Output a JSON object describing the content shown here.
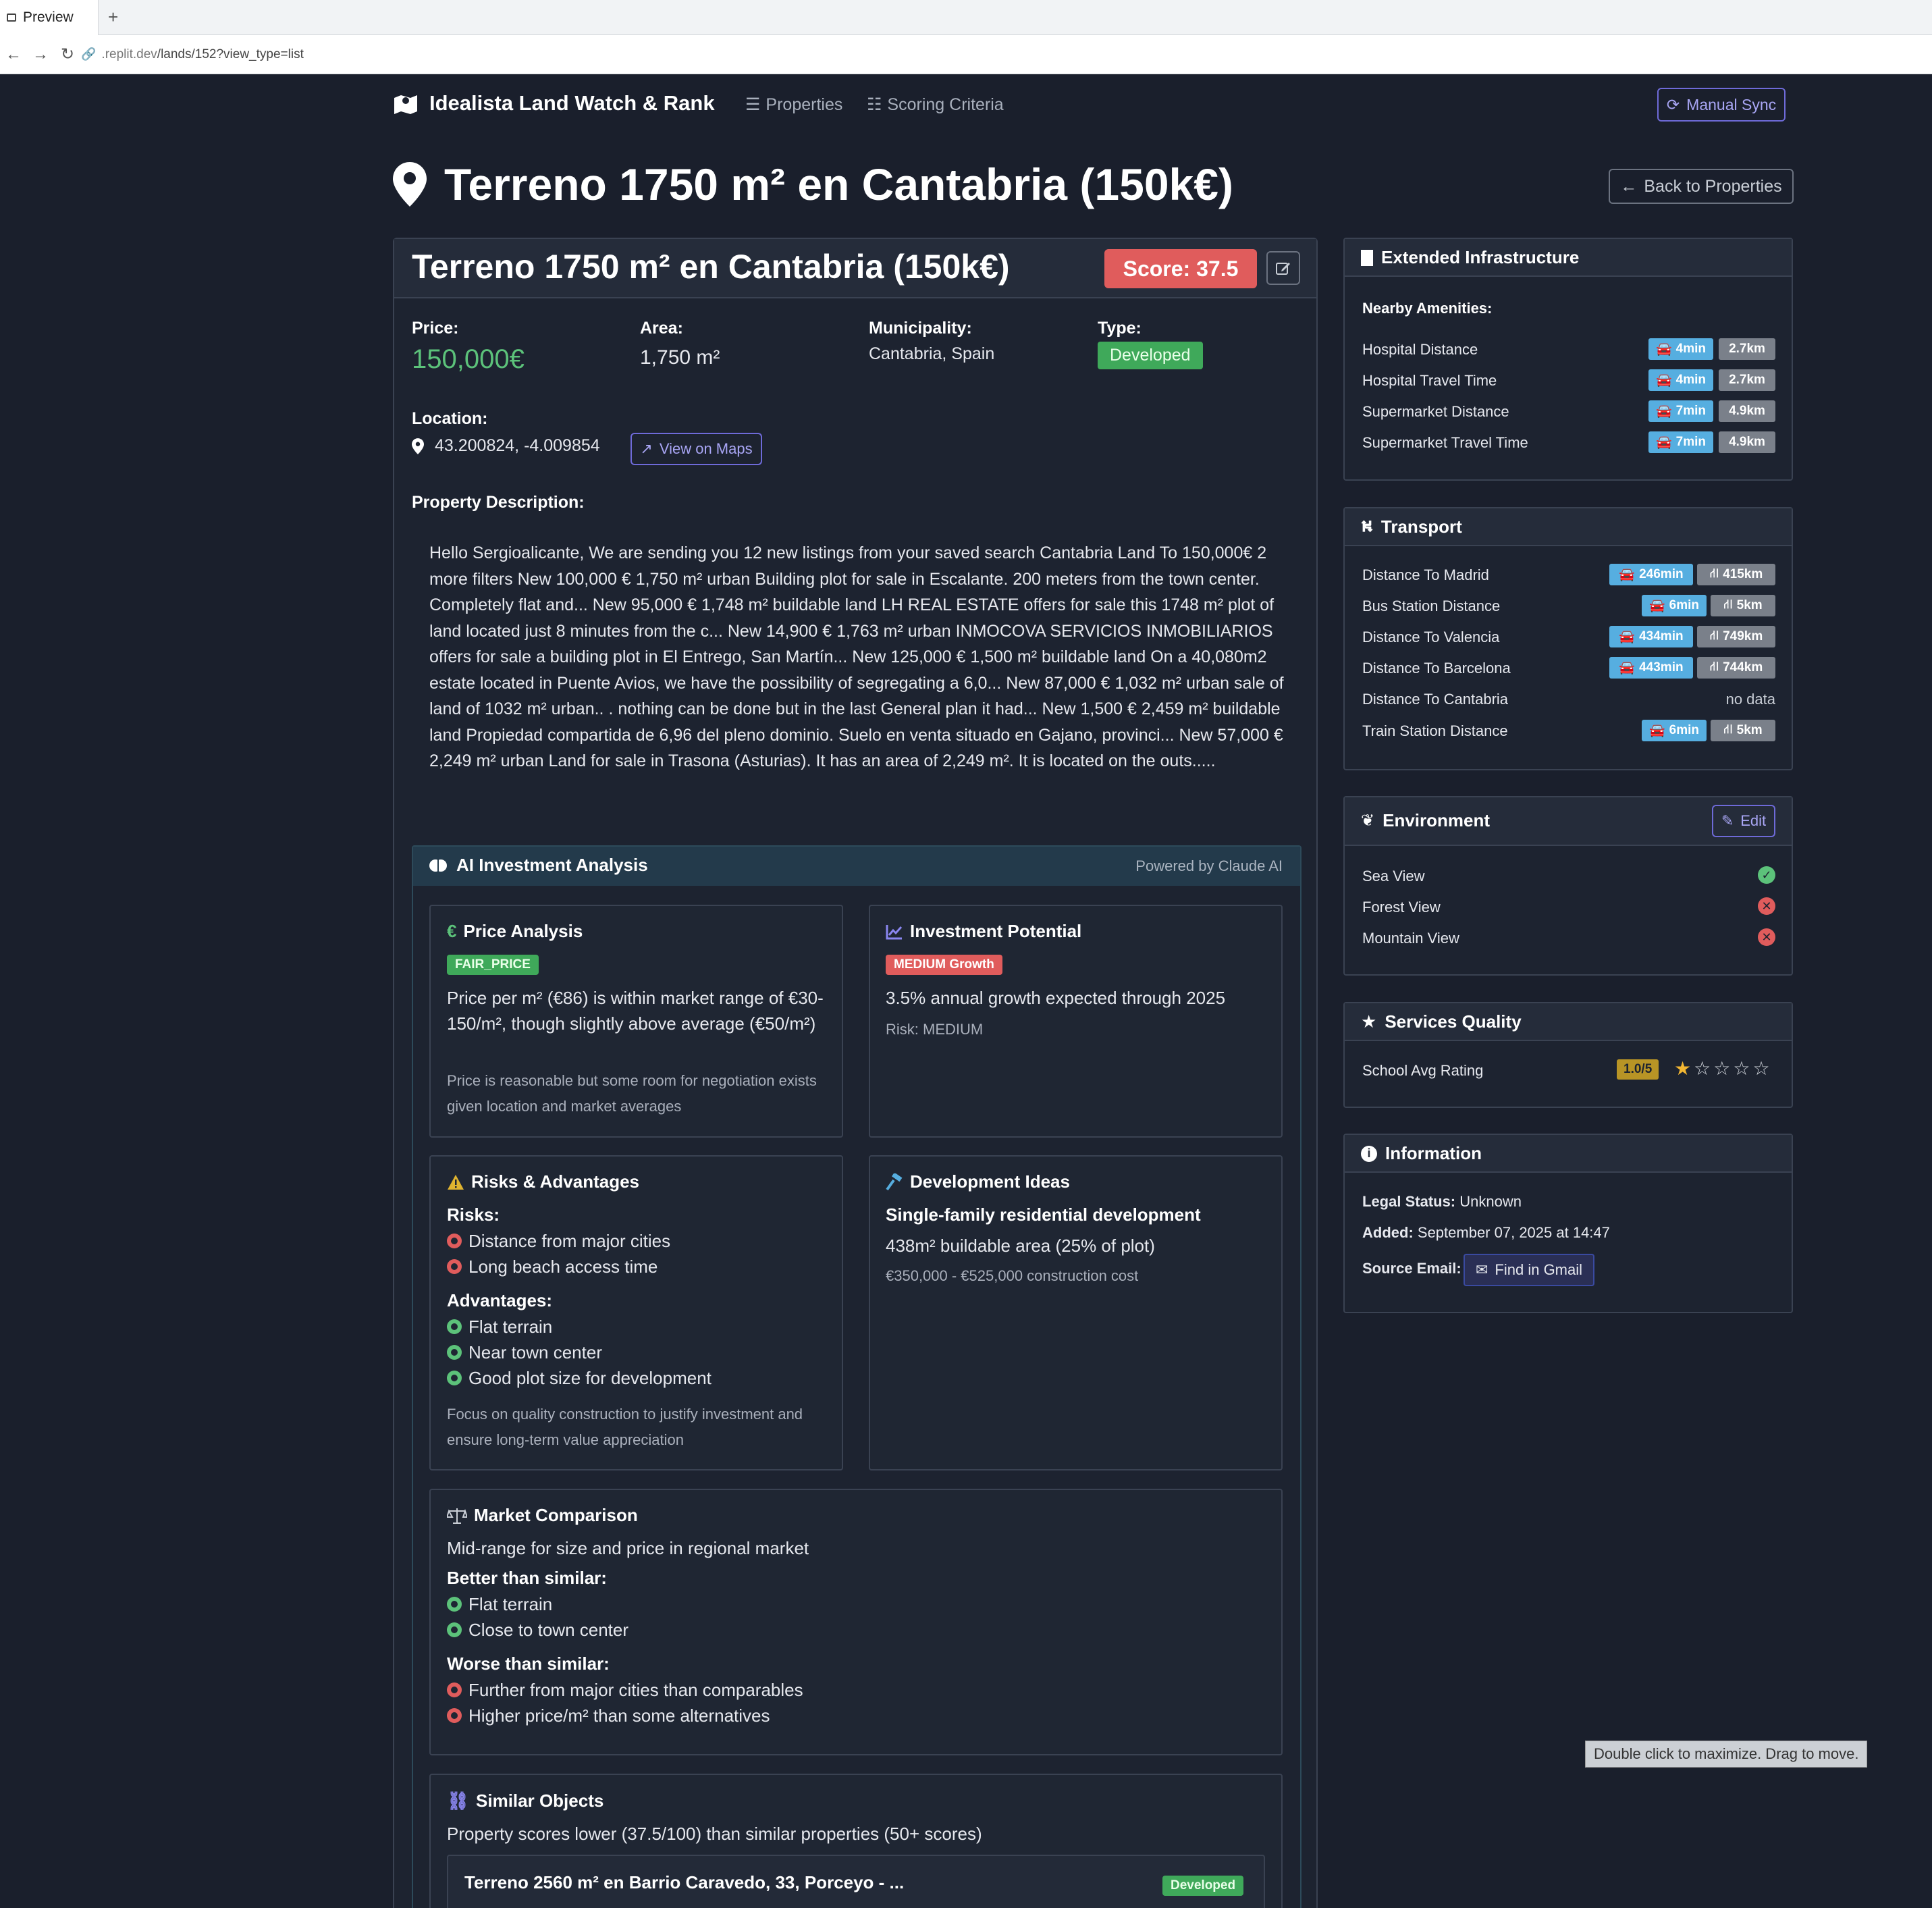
{
  "browser": {
    "tab_label": "Preview",
    "url_prefix": ".replit.dev",
    "url_path": "/lands/152?view_type=list"
  },
  "nav": {
    "brand": "Idealista Land Watch & Rank",
    "properties": "Properties",
    "scoring": "Scoring Criteria",
    "sync": "Manual Sync"
  },
  "page": {
    "title": "Terreno 1750 m² en Cantabria (150k€)",
    "back": "Back to Properties"
  },
  "property": {
    "title": "Terreno 1750 m² en Cantabria (150k€)",
    "score": "Score: 37.5",
    "price_label": "Price:",
    "price": "150,000€",
    "area_label": "Area:",
    "area": "1,750 m²",
    "municipality_label": "Municipality:",
    "municipality": "Cantabria, Spain",
    "type_label": "Type:",
    "type": "Developed",
    "location_label": "Location:",
    "coords": "43.200824, -4.009854",
    "view_maps": "View on Maps",
    "description_label": "Property Description:",
    "description": "Hello Sergioalicante, We are sending you 12 new listings from your saved search Cantabria Land To 150,000€ 2 more filters New 100,000 € 1,750 m² urban Building plot for sale in Escalante. 200 meters from the town center. Completely flat and... New 95,000 € 1,748 m² buildable land LH REAL ESTATE offers for sale this 1748 m² plot of land located just 8 minutes from the c... New 14,900 € 1,763 m² urban INMOCOVA SERVICIOS INMOBILIARIOS offers for sale a building plot in El Entrego, San Martín... New 125,000 € 1,500 m² buildable land On a 40,080m2 estate located in Puente Avios, we have the possibility of segregating a 6,0... New 87,000 € 1,032 m² urban sale of land of 1032 m² urban.. . nothing can be done but in the last General plan it had... New 1,500 € 2,459 m² buildable land Propiedad compartida de 6,96 del pleno dominio. Suelo en venta situado en Gajano, provinci... New 57,000 € 2,249 m² urban Land for sale in Trasona (Asturias). It has an area of 2,249 m². It is located on the outs....."
  },
  "ai": {
    "title": "AI Investment Analysis",
    "powered": "Powered by Claude AI",
    "price": {
      "title": "Price Analysis",
      "badge": "FAIR_PRICE",
      "text": "Price per m² (€86) is within market range of €30-150/m², though slightly above average (€50/m²)",
      "note": "Price is reasonable but some room for negotiation exists given location and market averages"
    },
    "investment": {
      "title": "Investment Potential",
      "badge": "MEDIUM Growth",
      "text": "3.5% annual growth expected through 2025",
      "risk": "Risk: MEDIUM"
    },
    "risks": {
      "title": "Risks & Advantages",
      "risks_label": "Risks:",
      "risks": [
        "Distance from major cities",
        "Long beach access time"
      ],
      "adv_label": "Advantages:",
      "advantages": [
        "Flat terrain",
        "Near town center",
        "Good plot size for development"
      ],
      "note": "Focus on quality construction to justify investment and ensure long-term value appreciation"
    },
    "dev": {
      "title": "Development Ideas",
      "headline": "Single-family residential development",
      "area": "438m² buildable area (25% of plot)",
      "cost": "€350,000 - €525,000 construction cost"
    },
    "market": {
      "title": "Market Comparison",
      "text": "Mid-range for size and price in regional market",
      "better_label": "Better than similar:",
      "better": [
        "Flat terrain",
        "Close to town center"
      ],
      "worse_label": "Worse than similar:",
      "worse": [
        "Further from major cities than comparables",
        "Higher price/m² than some alternatives"
      ]
    },
    "similar": {
      "title": "Similar Objects",
      "text": "Property scores lower (37.5/100) than similar properties (50+ scores)",
      "item_title": "Terreno 2560 m² en Barrio Caravedo, 33, Porceyo - ...",
      "item_badge": "Developed"
    }
  },
  "infra": {
    "title": "Extended Infrastructure",
    "sub": "Nearby Amenities:",
    "rows": [
      {
        "label": "Hospital Distance",
        "time": "4min",
        "dist": "2.7km"
      },
      {
        "label": "Hospital Travel Time",
        "time": "4min",
        "dist": "2.7km"
      },
      {
        "label": "Supermarket Distance",
        "time": "7min",
        "dist": "4.9km"
      },
      {
        "label": "Supermarket Travel Time",
        "time": "7min",
        "dist": "4.9km"
      }
    ]
  },
  "transport": {
    "title": "Transport",
    "rows": [
      {
        "label": "Distance To Madrid",
        "time": "246min",
        "dist": "415km"
      },
      {
        "label": "Bus Station Distance",
        "time": "6min",
        "dist": "5km"
      },
      {
        "label": "Distance To Valencia",
        "time": "434min",
        "dist": "749km"
      },
      {
        "label": "Distance To Barcelona",
        "time": "443min",
        "dist": "744km"
      },
      {
        "label": "Distance To Cantabria",
        "nodata": "no data"
      },
      {
        "label": "Train Station Distance",
        "time": "6min",
        "dist": "5km"
      }
    ]
  },
  "environment": {
    "title": "Environment",
    "edit": "Edit",
    "rows": [
      {
        "label": "Sea View",
        "ok": true
      },
      {
        "label": "Forest View",
        "ok": false
      },
      {
        "label": "Mountain View",
        "ok": false
      }
    ]
  },
  "services": {
    "title": "Services Quality",
    "label": "School Avg Rating",
    "rating": "1.0/5",
    "stars": 1
  },
  "info": {
    "title": "Information",
    "legal_label": "Legal Status:",
    "legal": "Unknown",
    "added_label": "Added:",
    "added": "September 07, 2025 at 14:47",
    "source_label": "Source Email:",
    "gmail": "Find in Gmail"
  },
  "tooltip": "Double click to maximize. Drag to move.",
  "colors": {
    "accent": "#6e6ad8",
    "danger": "#e05c5c",
    "success": "#5cc27a",
    "info": "#56aee0"
  }
}
